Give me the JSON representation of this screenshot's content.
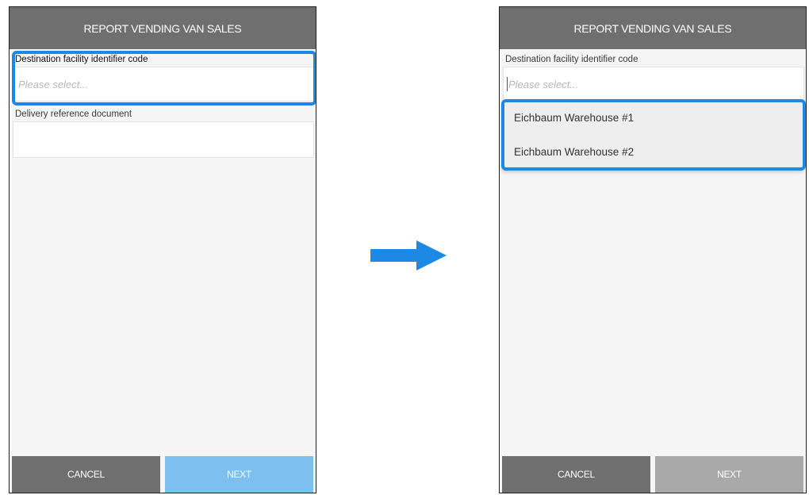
{
  "screens": [
    {
      "header_title": "REPORT VENDING VAN SALES",
      "destination_label": "Destination facility identifier code",
      "destination_placeholder": "Please select...",
      "delivery_label": "Delivery reference document",
      "cancel_label": "CANCEL",
      "next_label": "NEXT"
    },
    {
      "header_title": "REPORT VENDING VAN SALES",
      "destination_label": "Destination facility identifier code",
      "destination_placeholder": "Please select...",
      "dropdown_options": [
        "Eichbaum Warehouse #1",
        "Eichbaum Warehouse #2"
      ],
      "cancel_label": "CANCEL",
      "next_label": "NEXT"
    }
  ],
  "colors": {
    "header": "#6f6f6f",
    "highlight": "#1e88e5",
    "next_enabled": "#7dbfee",
    "next_disabled": "#a9a9a9",
    "arrow": "#1e88e5"
  },
  "icons": {
    "transition": "arrow-right-icon"
  }
}
